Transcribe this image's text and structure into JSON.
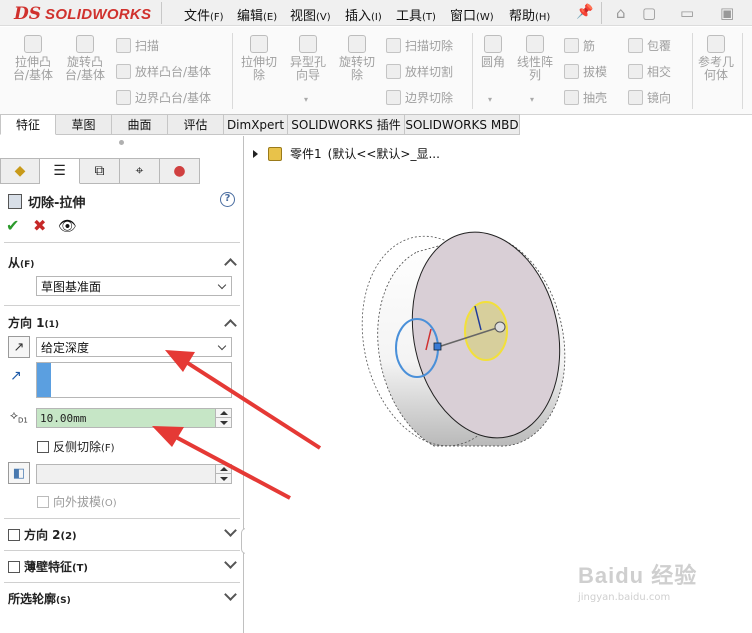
{
  "app": {
    "brand_ds": "DS",
    "brand_name": "SOLIDWORKS"
  },
  "menu": [
    {
      "label": "文件",
      "hotkey": "(F)"
    },
    {
      "label": "编辑",
      "hotkey": "(E)"
    },
    {
      "label": "视图",
      "hotkey": "(V)"
    },
    {
      "label": "插入",
      "hotkey": "(I)"
    },
    {
      "label": "工具",
      "hotkey": "(T)"
    },
    {
      "label": "窗口",
      "hotkey": "(W)"
    },
    {
      "label": "帮助",
      "hotkey": "(H)"
    }
  ],
  "ribbon": {
    "extrude_boss": "拉伸凸台/基体",
    "revolve_boss": "旋转凸台/基体",
    "sweep": "扫描",
    "loft_boss": "放样凸台/基体",
    "boundary_boss": "边界凸台/基体",
    "extrude_cut": "拉伸切除",
    "hole_wizard": "异型孔向导",
    "revolve_cut": "旋转切除",
    "sweep_cut": "扫描切除",
    "loft_cut": "放样切割",
    "boundary_cut": "边界切除",
    "fillet": "圆角",
    "linear_pattern": "线性阵列",
    "rib": "筋",
    "draft": "拔模",
    "shell": "抽壳",
    "wrap": "包覆",
    "intersect": "相交",
    "mirror": "镜向",
    "ref_geometry": "参考几何体"
  },
  "command_tabs": [
    "特征",
    "草图",
    "曲面",
    "评估",
    "DimXpert",
    "SOLIDWORKS 插件",
    "SOLIDWORKS MBD"
  ],
  "property_manager": {
    "title": "切除-拉伸",
    "help": "?",
    "from": {
      "label": "从",
      "hotkey": "(F)",
      "value": "草图基准面"
    },
    "direction1": {
      "label": "方向 1",
      "hotkey": "(1)",
      "end_condition": "给定深度",
      "depth": "10.00mm",
      "flip_side_label": "反侧切除",
      "flip_side_hotkey": "(F)",
      "draft_outward_label": "向外拔模",
      "draft_outward_hotkey": "(O)"
    },
    "direction2": {
      "label": "方向 2",
      "hotkey": "(2)"
    },
    "thin_feature": {
      "label": "薄壁特征",
      "hotkey": "(T)"
    },
    "selected_contours": {
      "label": "所选轮廓",
      "hotkey": "(S)"
    }
  },
  "viewport": {
    "part_name": "零件1",
    "config": "(默认<<默认>_显..."
  },
  "watermark": {
    "brand": "Baidu 经验",
    "url": "jingyan.baidu.com"
  },
  "colors": {
    "brand_red": "#d0312d",
    "depth_field_bg": "#c6e6c6",
    "arrow_red": "#e53935",
    "selection_yellow": "#f2e03a",
    "selection_blue": "#4a90d9"
  }
}
